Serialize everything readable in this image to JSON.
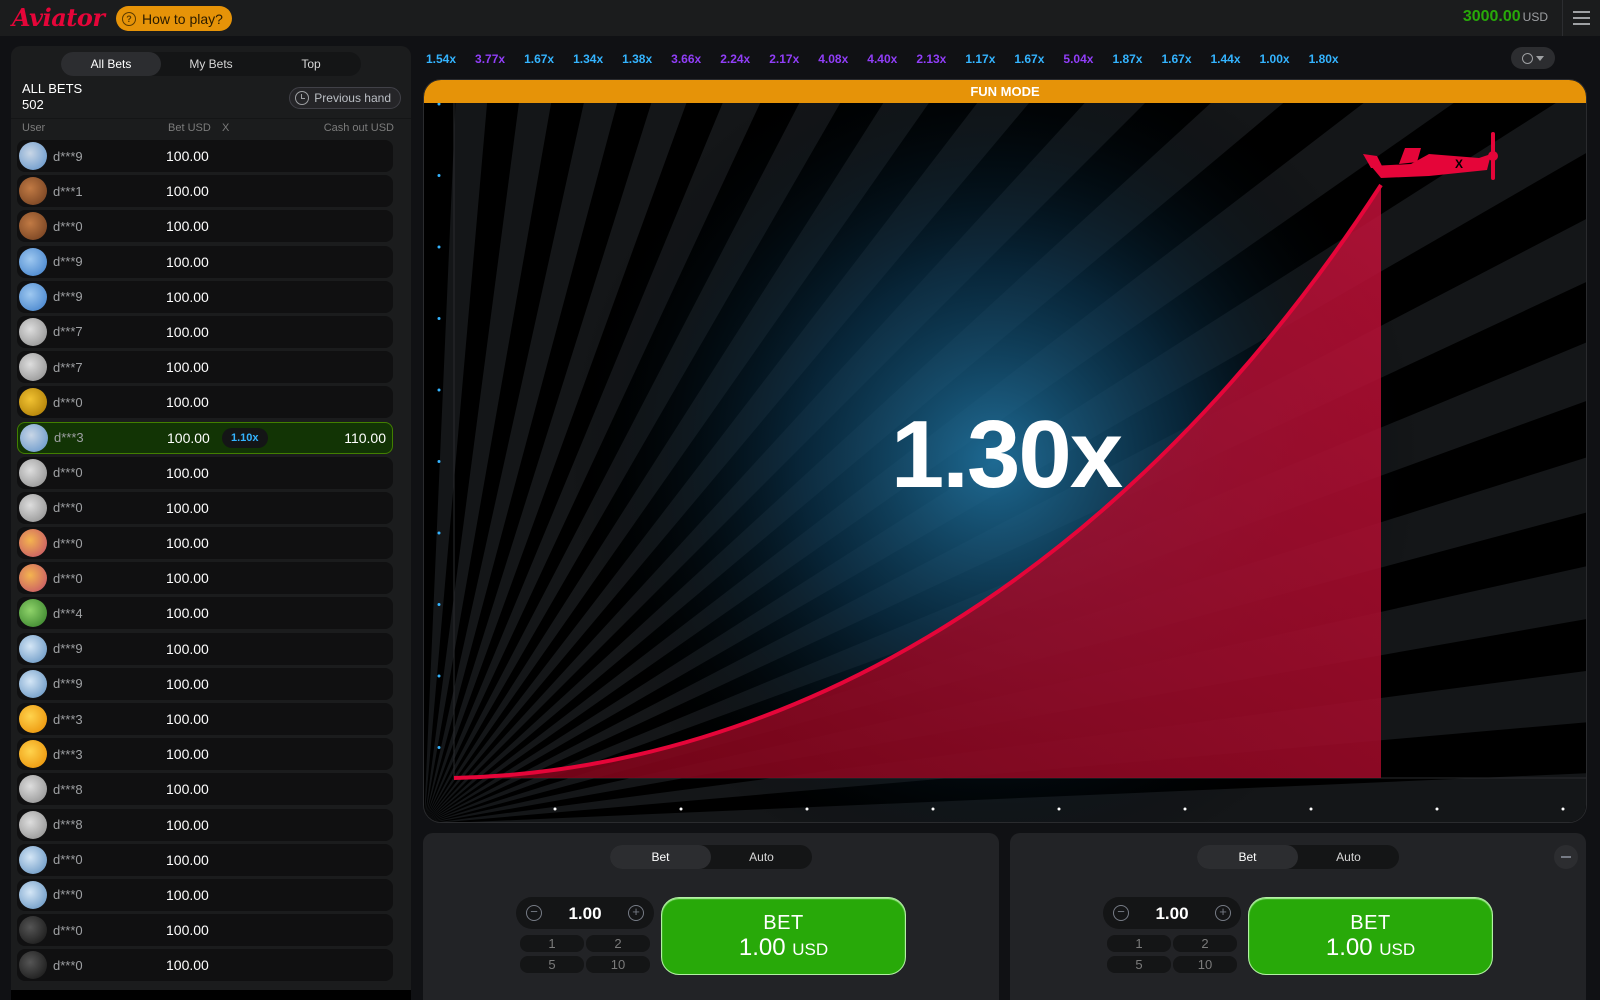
{
  "header": {
    "logo": "Aviator",
    "how_to_play": "How to play?",
    "balance": "3000.00",
    "currency": "USD"
  },
  "bets_panel": {
    "tabs": [
      "All Bets",
      "My Bets",
      "Top"
    ],
    "title": "ALL BETS",
    "count": "502",
    "previous_hand": "Previous hand",
    "columns": {
      "user": "User",
      "bet": "Bet USD",
      "x": "X",
      "cashout": "Cash out USD"
    },
    "rows": [
      {
        "user": "d***9",
        "bet": "100.00",
        "avatar": "plane",
        "mult": "",
        "cashout": ""
      },
      {
        "user": "d***1",
        "bet": "100.00",
        "avatar": "brown",
        "mult": "",
        "cashout": ""
      },
      {
        "user": "d***0",
        "bet": "100.00",
        "avatar": "brown",
        "mult": "",
        "cashout": ""
      },
      {
        "user": "d***9",
        "bet": "100.00",
        "avatar": "blue",
        "mult": "",
        "cashout": ""
      },
      {
        "user": "d***9",
        "bet": "100.00",
        "avatar": "blue",
        "mult": "",
        "cashout": ""
      },
      {
        "user": "d***7",
        "bet": "100.00",
        "avatar": "grey",
        "mult": "",
        "cashout": ""
      },
      {
        "user": "d***7",
        "bet": "100.00",
        "avatar": "grey",
        "mult": "",
        "cashout": ""
      },
      {
        "user": "d***0",
        "bet": "100.00",
        "avatar": "gold",
        "mult": "",
        "cashout": ""
      },
      {
        "user": "d***3",
        "bet": "100.00",
        "avatar": "plane",
        "mult": "1.10x",
        "cashout": "110.00"
      },
      {
        "user": "d***0",
        "bet": "100.00",
        "avatar": "grey",
        "mult": "",
        "cashout": ""
      },
      {
        "user": "d***0",
        "bet": "100.00",
        "avatar": "grey",
        "mult": "",
        "cashout": ""
      },
      {
        "user": "d***0",
        "bet": "100.00",
        "avatar": "pink",
        "mult": "",
        "cashout": ""
      },
      {
        "user": "d***0",
        "bet": "100.00",
        "avatar": "pink",
        "mult": "",
        "cashout": ""
      },
      {
        "user": "d***4",
        "bet": "100.00",
        "avatar": "green",
        "mult": "",
        "cashout": ""
      },
      {
        "user": "d***9",
        "bet": "100.00",
        "avatar": "lightblue",
        "mult": "",
        "cashout": ""
      },
      {
        "user": "d***9",
        "bet": "100.00",
        "avatar": "lightblue",
        "mult": "",
        "cashout": ""
      },
      {
        "user": "d***3",
        "bet": "100.00",
        "avatar": "orange",
        "mult": "",
        "cashout": ""
      },
      {
        "user": "d***3",
        "bet": "100.00",
        "avatar": "orange",
        "mult": "",
        "cashout": ""
      },
      {
        "user": "d***8",
        "bet": "100.00",
        "avatar": "grey",
        "mult": "",
        "cashout": ""
      },
      {
        "user": "d***8",
        "bet": "100.00",
        "avatar": "grey",
        "mult": "",
        "cashout": ""
      },
      {
        "user": "d***0",
        "bet": "100.00",
        "avatar": "lightblue",
        "mult": "",
        "cashout": ""
      },
      {
        "user": "d***0",
        "bet": "100.00",
        "avatar": "lightblue",
        "mult": "",
        "cashout": ""
      },
      {
        "user": "d***0",
        "bet": "100.00",
        "avatar": "dark",
        "mult": "",
        "cashout": ""
      },
      {
        "user": "d***0",
        "bet": "100.00",
        "avatar": "dark",
        "mult": "",
        "cashout": ""
      }
    ]
  },
  "history": [
    {
      "value": "1.54x",
      "color": "#34b4ff"
    },
    {
      "value": "3.77x",
      "color": "#913ef8"
    },
    {
      "value": "1.67x",
      "color": "#34b4ff"
    },
    {
      "value": "1.34x",
      "color": "#34b4ff"
    },
    {
      "value": "1.38x",
      "color": "#34b4ff"
    },
    {
      "value": "3.66x",
      "color": "#913ef8"
    },
    {
      "value": "2.24x",
      "color": "#913ef8"
    },
    {
      "value": "2.17x",
      "color": "#913ef8"
    },
    {
      "value": "4.08x",
      "color": "#913ef8"
    },
    {
      "value": "4.40x",
      "color": "#913ef8"
    },
    {
      "value": "2.13x",
      "color": "#913ef8"
    },
    {
      "value": "1.17x",
      "color": "#34b4ff"
    },
    {
      "value": "1.67x",
      "color": "#34b4ff"
    },
    {
      "value": "5.04x",
      "color": "#913ef8"
    },
    {
      "value": "1.87x",
      "color": "#34b4ff"
    },
    {
      "value": "1.67x",
      "color": "#34b4ff"
    },
    {
      "value": "1.44x",
      "color": "#34b4ff"
    },
    {
      "value": "1.00x",
      "color": "#34b4ff"
    },
    {
      "value": "1.80x",
      "color": "#34b4ff"
    }
  ],
  "game": {
    "mode_label": "FUN MODE",
    "multiplier": "1.30x",
    "accent": "#e50539"
  },
  "bet_panels": [
    {
      "tabs": [
        "Bet",
        "Auto"
      ],
      "amount": "1.00",
      "quick": [
        "1",
        "2",
        "5",
        "10"
      ],
      "button_line1": "BET",
      "button_amount": "1.00",
      "button_currency": "USD"
    },
    {
      "tabs": [
        "Bet",
        "Auto"
      ],
      "amount": "1.00",
      "quick": [
        "1",
        "2",
        "5",
        "10"
      ],
      "button_line1": "BET",
      "button_amount": "1.00",
      "button_currency": "USD"
    }
  ]
}
